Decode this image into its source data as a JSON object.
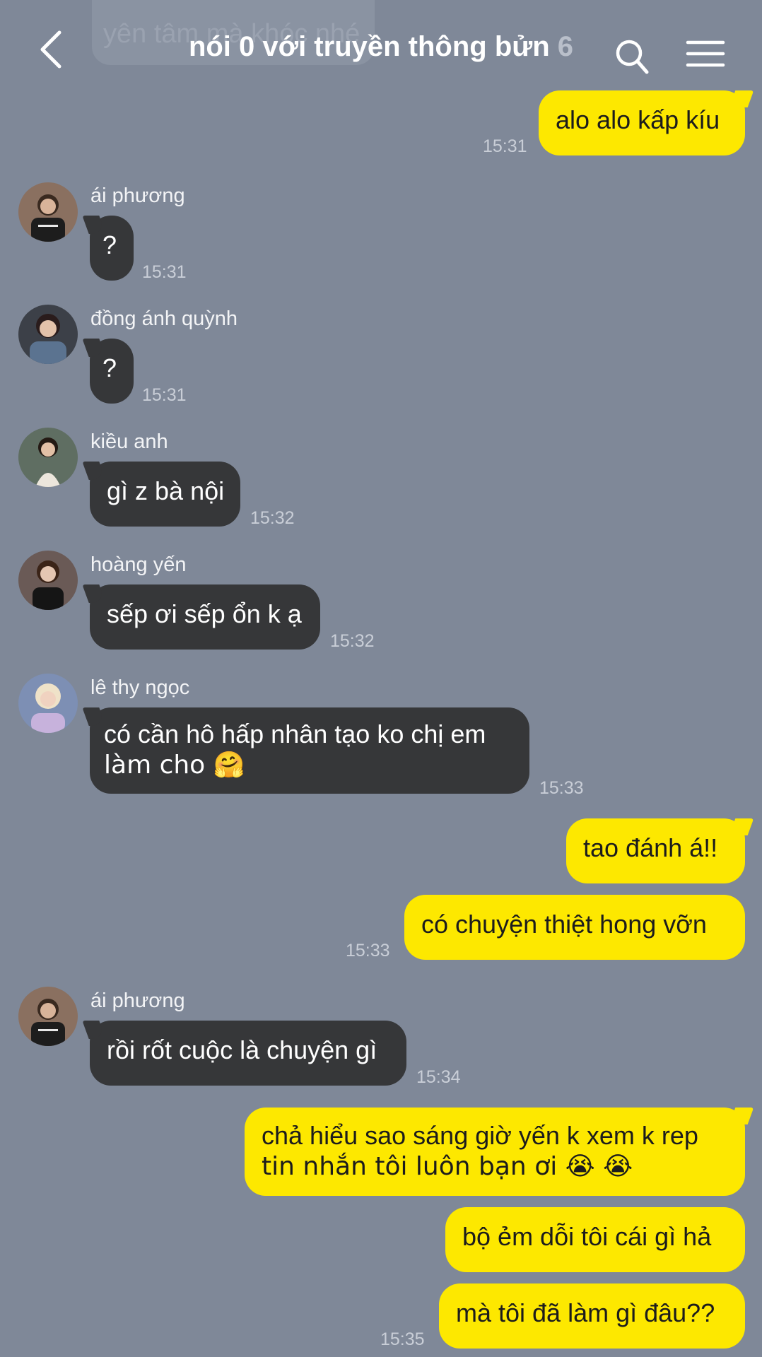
{
  "header": {
    "ghost_text": "yên tâm mà khóc nhé",
    "title": "nói 0 với truyền thông bửn",
    "member_count": "6",
    "back_icon": "chevron-left-icon",
    "search_icon": "search-icon",
    "menu_icon": "hamburger-menu-icon"
  },
  "colors": {
    "background": "#7f8898",
    "incoming_bubble": "#363739",
    "outgoing_bubble": "#fde800",
    "timestamp": "#c9ced7"
  },
  "messages": [
    {
      "sender": "",
      "text": "alo alo kấp kíu",
      "time": "15:31",
      "outgoing": true
    },
    {
      "sender": "ái phương",
      "text": "?",
      "time": "15:31",
      "outgoing": false
    },
    {
      "sender": "đồng ánh quỳnh",
      "text": "?",
      "time": "15:31",
      "outgoing": false
    },
    {
      "sender": "kiều anh",
      "text": "gì z bà nội",
      "time": "15:32",
      "outgoing": false
    },
    {
      "sender": "hoàng yến",
      "text": "sếp ơi sếp ổn k ạ",
      "time": "15:32",
      "outgoing": false
    },
    {
      "sender": "lê thy ngọc",
      "text_line1": "có cần hô hấp nhân tạo ko chị em",
      "text_line2": "làm cho 🤗",
      "time": "15:33",
      "outgoing": false
    },
    {
      "sender": "",
      "text": "tao đánh á!!",
      "time": "",
      "outgoing": true
    },
    {
      "sender": "",
      "text": "có chuyện thiệt hong vỡn",
      "time": "15:33",
      "outgoing": true
    },
    {
      "sender": "ái phương",
      "text": "rồi rốt cuộc là chuyện gì",
      "time": "15:34",
      "outgoing": false
    },
    {
      "sender": "",
      "text_line1": "chả hiểu sao sáng giờ yến k xem k rep",
      "text_line2": "tin nhắn tôi luôn bạn ơi 😭 😭",
      "time": "",
      "outgoing": true
    },
    {
      "sender": "",
      "text": "bộ ẻm dỗi tôi cái gì hả",
      "time": "",
      "outgoing": true
    },
    {
      "sender": "",
      "text": "mà tôi đã làm gì đâu??",
      "time": "15:35",
      "outgoing": true
    }
  ]
}
